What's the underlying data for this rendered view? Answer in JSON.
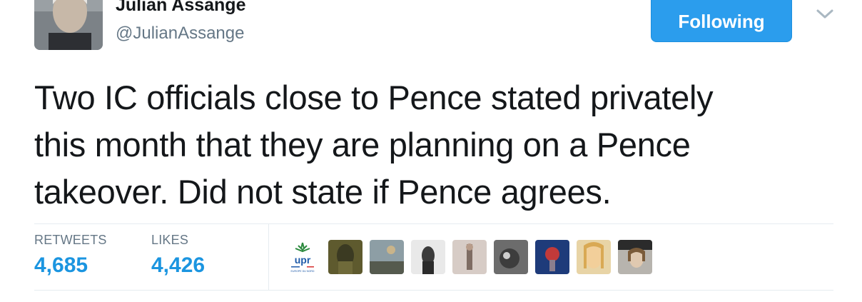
{
  "author": {
    "name": "Julian Assange",
    "handle": "@JulianAssange"
  },
  "follow_button": {
    "label": "Following"
  },
  "tweet": {
    "text_lines": [
      "Two IC officials close to Pence stated privately",
      "this month that they are planning on a Pence",
      "takeover. Did not state if Pence agrees."
    ]
  },
  "stats": {
    "retweets_label": "RETWEETS",
    "retweets_count": "4,685",
    "likes_label": "LIKES",
    "likes_count": "4,426"
  },
  "likers": {
    "first_logo": {
      "name": "upr",
      "sub": "EUROPE DU NORD"
    }
  },
  "colors": {
    "accent": "#1b95e0",
    "button": "#2b9ded",
    "muted": "#657786"
  }
}
